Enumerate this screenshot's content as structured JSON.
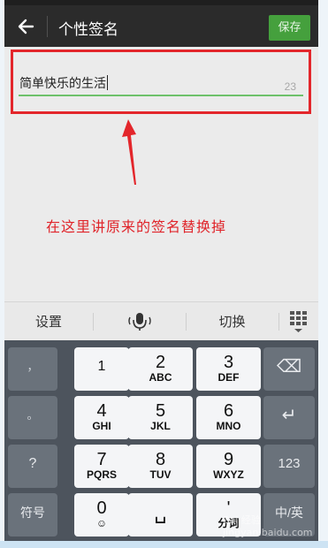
{
  "titlebar": {
    "title": "个性签名",
    "save_label": "保存",
    "back_icon": "arrow-left-icon"
  },
  "signature": {
    "value": "简单快乐的生活",
    "remaining_chars": "23"
  },
  "annotation": {
    "text": "在这里讲原来的签名替换掉",
    "color": "#e0242a"
  },
  "suggestion_bar": {
    "settings_label": "设置",
    "voice_icon": "microphone-icon",
    "switch_label": "切换",
    "grid_icon": "keyboard-grid-icon"
  },
  "keyboard": {
    "rows": [
      [
        {
          "main": "，",
          "sub": "",
          "type": "fn"
        },
        {
          "main": "1",
          "sub": "",
          "type": "num"
        },
        {
          "main": "2",
          "sub": "ABC",
          "type": "num"
        },
        {
          "main": "3",
          "sub": "DEF",
          "type": "num"
        },
        {
          "main": "⌫",
          "sub": "",
          "type": "fn"
        }
      ],
      [
        {
          "main": "。",
          "sub": "",
          "type": "fn"
        },
        {
          "main": "4",
          "sub": "GHI",
          "type": "num"
        },
        {
          "main": "5",
          "sub": "JKL",
          "type": "num"
        },
        {
          "main": "6",
          "sub": "MNO",
          "type": "num"
        },
        {
          "main": "↵",
          "sub": "",
          "type": "fn"
        }
      ],
      [
        {
          "main": "?",
          "sub": "",
          "type": "fn"
        },
        {
          "main": "7",
          "sub": "PQRS",
          "type": "num"
        },
        {
          "main": "8",
          "sub": "TUV",
          "type": "num"
        },
        {
          "main": "9",
          "sub": "WXYZ",
          "type": "num"
        },
        {
          "main": "123",
          "sub": "",
          "type": "fn"
        }
      ],
      [
        {
          "main": "符号",
          "sub": "",
          "type": "fn"
        },
        {
          "main": "0",
          "sub": "☺",
          "type": "num"
        },
        {
          "main": "␣",
          "sub": "",
          "type": "num"
        },
        {
          "main": "'",
          "sub": "分词",
          "type": "num"
        },
        {
          "main": "中/英",
          "sub": "",
          "type": "fn"
        }
      ]
    ]
  },
  "watermark": "Bai 经验 jingyan.baidu.com",
  "colors": {
    "titlebar": "#2b2b2b",
    "save_button": "#45a03d",
    "highlight": "#e3262b",
    "input_underline": "#6ec16a",
    "keyboard_bg": "#4d545d"
  }
}
